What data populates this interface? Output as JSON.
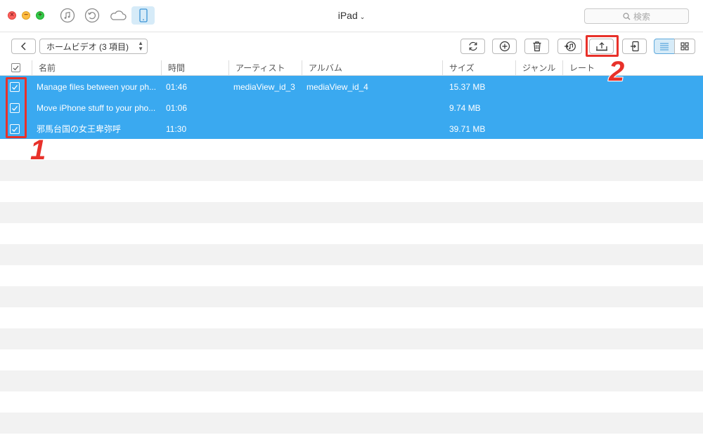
{
  "window": {
    "title": "iPad",
    "title_chevron": "⌄",
    "search_placeholder": "検索"
  },
  "nav": {
    "icons": [
      "itunes-icon",
      "backup-icon",
      "icloud-icon",
      "ipad-icon"
    ],
    "active": "ipad-icon"
  },
  "toolbar": {
    "folder_label": "ホームビデオ (3 項目)",
    "buttons": [
      "refresh-icon",
      "add-icon",
      "delete-icon",
      "to-itunes-icon",
      "export-to-computer-icon",
      "send-to-device-icon",
      "list-view-icon",
      "grid-view-icon"
    ],
    "active_view": "list"
  },
  "table": {
    "columns": {
      "name": "名前",
      "time": "時間",
      "artist": "アーティスト",
      "album": "アルバム",
      "size": "サイズ",
      "genre": "ジャンル",
      "rate": "レート"
    },
    "rows": [
      {
        "name": "Manage files between your ph...",
        "time": "01:46",
        "artist": "mediaView_id_3",
        "album": "mediaView_id_4",
        "size": "15.37 MB",
        "checked": true
      },
      {
        "name": "Move iPhone stuff to your pho...",
        "time": "01:06",
        "artist": "",
        "album": "",
        "size": "9.74 MB",
        "checked": true
      },
      {
        "name": "邪馬台国の女王卑弥呼",
        "time": "11:30",
        "artist": "",
        "album": "",
        "size": "39.71 MB",
        "checked": true
      }
    ]
  },
  "annotations": {
    "step1": "1",
    "step2": "2"
  },
  "colors": {
    "selection": "#3aa9f0",
    "highlight": "#e8312a",
    "active_tab": "#d6ebf8"
  }
}
